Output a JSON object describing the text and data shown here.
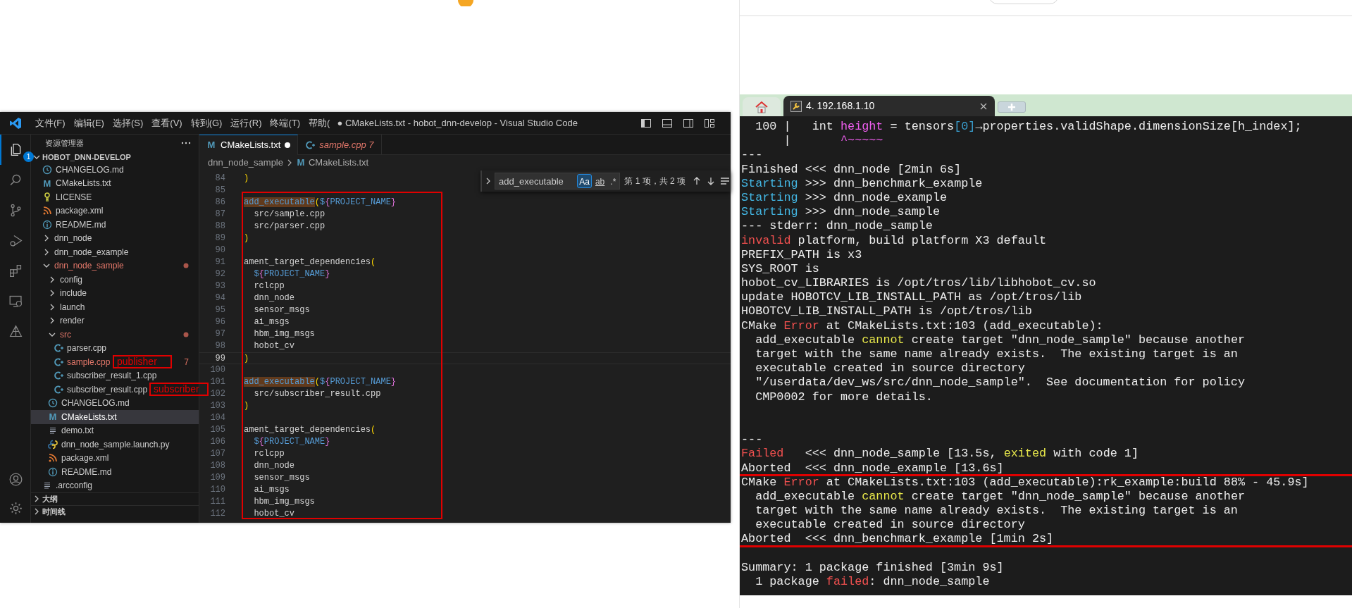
{
  "vscode": {
    "menu": [
      "文件(F)",
      "编辑(E)",
      "选择(S)",
      "查看(V)",
      "转到(G)",
      "运行(R)",
      "终端(T)",
      "帮助("
    ],
    "title": "● CMakeLists.txt - hobot_dnn-develop - Visual Studio Code",
    "activity_bar": [
      {
        "kind": "explorer",
        "selected": true,
        "badge": "1"
      },
      {
        "kind": "search",
        "selected": false
      },
      {
        "kind": "source_control",
        "selected": false
      },
      {
        "kind": "run",
        "selected": false
      },
      {
        "kind": "extensions",
        "selected": false
      },
      {
        "kind": "remote",
        "selected": false
      },
      {
        "kind": "deploy",
        "selected": false
      },
      {
        "kind": "account",
        "selected": false
      },
      {
        "kind": "settings",
        "selected": false
      }
    ],
    "explorer": {
      "title": "资源管理器",
      "root": {
        "label": "HOBOT_DNN-DEVELOP",
        "expanded": true,
        "children": [
          {
            "label": "CHANGELOG.md",
            "kind": "changelog",
            "modified": false,
            "selected": false
          },
          {
            "label": "CMakeLists.txt",
            "kind": "cmake",
            "glyph": "M",
            "modified": false,
            "selected": false
          },
          {
            "label": "LICENSE",
            "kind": "license",
            "modified": false,
            "selected": false
          },
          {
            "label": "package.xml",
            "kind": "xml",
            "modified": false,
            "selected": false
          },
          {
            "label": "README.md",
            "kind": "info",
            "modified": false,
            "selected": false
          },
          {
            "label": "dnn_node",
            "kind": "folder",
            "expanded": false,
            "modified": false,
            "selected": false
          },
          {
            "label": "dnn_node_example",
            "kind": "folder",
            "expanded": false,
            "modified": false,
            "selected": false
          },
          {
            "label": "dnn_node_sample",
            "kind": "folder",
            "expanded": true,
            "modified": true,
            "selected": false,
            "children": [
              {
                "label": "config",
                "kind": "folder",
                "expanded": false,
                "modified": false,
                "selected": false
              },
              {
                "label": "include",
                "kind": "folder",
                "expanded": false,
                "modified": false,
                "selected": false
              },
              {
                "label": "launch",
                "kind": "folder",
                "expanded": false,
                "modified": false,
                "selected": false
              },
              {
                "label": "render",
                "kind": "folder",
                "expanded": false,
                "modified": false,
                "selected": false
              },
              {
                "label": "src",
                "kind": "folder",
                "expanded": true,
                "modified": true,
                "selected": false,
                "children": [
                  {
                    "label": "parser.cpp",
                    "kind": "cpp",
                    "modified": false,
                    "selected": false
                  },
                  {
                    "label": "sample.cpp",
                    "kind": "cpp",
                    "modified": true,
                    "badge": "7",
                    "selected": false
                  },
                  {
                    "label": "subscriber_result_1.cpp",
                    "kind": "cpp",
                    "modified": false,
                    "selected": false
                  },
                  {
                    "label": "subscriber_result.cpp",
                    "kind": "cpp",
                    "modified": false,
                    "selected": false
                  }
                ]
              },
              {
                "label": "CHANGELOG.md",
                "kind": "changelog",
                "modified": false,
                "selected": false
              },
              {
                "label": "CMakeLists.txt",
                "kind": "cmake",
                "glyph": "M",
                "modified": false,
                "selected": true
              },
              {
                "label": "demo.txt",
                "kind": "text",
                "modified": false,
                "selected": false
              },
              {
                "label": "dnn_node_sample.launch.py",
                "kind": "python",
                "modified": false,
                "selected": false
              },
              {
                "label": "package.xml",
                "kind": "xml",
                "modified": false,
                "selected": false
              },
              {
                "label": "README.md",
                "kind": "info",
                "modified": false,
                "selected": false
              }
            ]
          },
          {
            "label": ".arcconfig",
            "kind": "text",
            "modified": false,
            "selected": false
          }
        ]
      },
      "sections": [
        {
          "label": "大纲",
          "expanded": false
        },
        {
          "label": "时间线",
          "expanded": false
        }
      ]
    },
    "tabs": [
      {
        "label": "CMakeLists.txt",
        "kind": "cmake",
        "glyph": "M",
        "selected": true,
        "dirty": true,
        "preview": false,
        "errors": false
      },
      {
        "label": "sample.cpp 7",
        "kind": "cpp",
        "selected": false,
        "dirty": false,
        "preview": true,
        "errors": true
      }
    ],
    "breadcrumb": [
      {
        "label": "dnn_node_sample",
        "kind": "folder"
      },
      {
        "label": "CMakeLists.txt",
        "kind": "cmake",
        "glyph": "M"
      }
    ],
    "find": {
      "value": "add_executable",
      "options": [
        {
          "label": "Aa",
          "on": true
        },
        {
          "label": "ab",
          "on": false
        },
        {
          "label": ".*",
          "on": false
        }
      ],
      "result": "第 1 项，共 2 项"
    },
    "code": [
      {
        "number": "84",
        "current": false,
        "tokens": [
          {
            "text": ")",
            "kind": "paren"
          }
        ]
      },
      {
        "number": "85",
        "current": false
      },
      {
        "number": "86",
        "current": false,
        "tokens": [
          {
            "text": "add_executable",
            "kind": "match"
          },
          {
            "text": "(",
            "kind": "paren"
          },
          {
            "text": "$",
            "kind": "var"
          },
          {
            "text": "{",
            "kind": "brace"
          },
          {
            "text": "PROJECT_NAME",
            "kind": "var"
          },
          {
            "text": "}",
            "kind": "brace"
          }
        ]
      },
      {
        "number": "87",
        "current": false,
        "tokens": [
          {
            "text": "  src/sample.cpp"
          }
        ]
      },
      {
        "number": "88",
        "current": false,
        "tokens": [
          {
            "text": "  src/parser.cpp"
          }
        ]
      },
      {
        "number": "89",
        "current": false,
        "tokens": [
          {
            "text": ")",
            "kind": "paren"
          }
        ]
      },
      {
        "number": "90",
        "current": false
      },
      {
        "number": "91",
        "current": false,
        "tokens": [
          {
            "text": "ament_target_dependencies"
          },
          {
            "text": "(",
            "kind": "paren"
          }
        ]
      },
      {
        "number": "92",
        "current": false,
        "tokens": [
          {
            "text": "  $",
            "kind": "var"
          },
          {
            "text": "{",
            "kind": "brace"
          },
          {
            "text": "PROJECT_NAME",
            "kind": "var"
          },
          {
            "text": "}",
            "kind": "brace"
          }
        ]
      },
      {
        "number": "93",
        "current": false,
        "tokens": [
          {
            "text": "  rclcpp"
          }
        ]
      },
      {
        "number": "94",
        "current": false,
        "tokens": [
          {
            "text": "  dnn_node"
          }
        ]
      },
      {
        "number": "95",
        "current": false,
        "tokens": [
          {
            "text": "  sensor_msgs"
          }
        ]
      },
      {
        "number": "96",
        "current": false,
        "tokens": [
          {
            "text": "  ai_msgs"
          }
        ]
      },
      {
        "number": "97",
        "current": false,
        "tokens": [
          {
            "text": "  hbm_img_msgs"
          }
        ]
      },
      {
        "number": "98",
        "current": false,
        "tokens": [
          {
            "text": "  hobot_cv"
          }
        ]
      },
      {
        "number": "99",
        "current": true,
        "tokens": [
          {
            "text": ")",
            "kind": "paren"
          }
        ]
      },
      {
        "number": "100",
        "current": false
      },
      {
        "number": "101",
        "current": false,
        "tokens": [
          {
            "text": "add_executable",
            "kind": "match"
          },
          {
            "text": "(",
            "kind": "paren"
          },
          {
            "text": "$",
            "kind": "var"
          },
          {
            "text": "{",
            "kind": "brace"
          },
          {
            "text": "PROJECT_NAME",
            "kind": "var"
          },
          {
            "text": "}",
            "kind": "brace"
          }
        ]
      },
      {
        "number": "102",
        "current": false,
        "tokens": [
          {
            "text": "  src/subscriber_result.cpp"
          }
        ]
      },
      {
        "number": "103",
        "current": false,
        "tokens": [
          {
            "text": ")",
            "kind": "paren"
          }
        ]
      },
      {
        "number": "104",
        "current": false
      },
      {
        "number": "105",
        "current": false,
        "tokens": [
          {
            "text": "ament_target_dependencies"
          },
          {
            "text": "(",
            "kind": "paren"
          }
        ]
      },
      {
        "number": "106",
        "current": false,
        "tokens": [
          {
            "text": "  $",
            "kind": "var"
          },
          {
            "text": "{",
            "kind": "brace"
          },
          {
            "text": "PROJECT_NAME",
            "kind": "var"
          },
          {
            "text": "}",
            "kind": "brace"
          }
        ]
      },
      {
        "number": "107",
        "current": false,
        "tokens": [
          {
            "text": "  rclcpp"
          }
        ]
      },
      {
        "number": "108",
        "current": false,
        "tokens": [
          {
            "text": "  dnn_node"
          }
        ]
      },
      {
        "number": "109",
        "current": false,
        "tokens": [
          {
            "text": "  sensor_msgs"
          }
        ]
      },
      {
        "number": "110",
        "current": false,
        "tokens": [
          {
            "text": "  ai_msgs"
          }
        ]
      },
      {
        "number": "111",
        "current": false,
        "tokens": [
          {
            "text": "  hbm_img_msgs"
          }
        ]
      },
      {
        "number": "112",
        "current": false,
        "tokens": [
          {
            "text": "  hobot_cv"
          }
        ]
      }
    ],
    "annotations": [
      {
        "label": "publisher"
      },
      {
        "label": "subscriber"
      }
    ]
  },
  "terminal": {
    "tabs": [
      {
        "kind": "home",
        "selected": false
      },
      {
        "kind": "session",
        "label": "4. 192.168.1.10",
        "selected": true
      }
    ],
    "lines": [
      {
        "kind": "text",
        "segments": [
          {
            "text": "  100 |   int "
          },
          {
            "text": "height",
            "kind": "magenta"
          },
          {
            "text": " = tensors"
          },
          {
            "text": "[0]",
            "kind": "blue"
          },
          {
            "text": "→properties.validShape.dimensionSize[h_index];"
          }
        ]
      },
      {
        "kind": "text",
        "segments": [
          {
            "text": "      |       "
          },
          {
            "text": "^~~~~~",
            "kind": "magenta"
          }
        ]
      },
      {
        "kind": "text",
        "segments": [
          {
            "text": "---"
          }
        ]
      },
      {
        "kind": "text",
        "segments": [
          {
            "text": "Finished <<< dnn_node [2min 6s]"
          }
        ]
      },
      {
        "kind": "text",
        "segments": [
          {
            "text": "Starting",
            "kind": "cyan"
          },
          {
            "text": " >>> dnn_benchmark_example"
          }
        ]
      },
      {
        "kind": "text",
        "segments": [
          {
            "text": "Starting",
            "kind": "cyan"
          },
          {
            "text": " >>> dnn_node_example"
          }
        ]
      },
      {
        "kind": "text",
        "segments": [
          {
            "text": "Starting",
            "kind": "cyan"
          },
          {
            "text": " >>> dnn_node_sample"
          }
        ]
      },
      {
        "kind": "text",
        "segments": [
          {
            "text": "--- stderr: dnn_node_sample"
          }
        ]
      },
      {
        "kind": "text",
        "segments": [
          {
            "text": "invalid",
            "kind": "red"
          },
          {
            "text": " platform, build platform X3 default"
          }
        ]
      },
      {
        "kind": "text",
        "segments": [
          {
            "text": "PREFIX_PATH is x3"
          }
        ]
      },
      {
        "kind": "text",
        "segments": [
          {
            "text": "SYS_ROOT is"
          }
        ]
      },
      {
        "kind": "text",
        "segments": [
          {
            "text": "hobot_cv_LIBRARIES is /opt/tros/lib/libhobot_cv.so"
          }
        ]
      },
      {
        "kind": "text",
        "segments": [
          {
            "text": "update HOBOTCV_LIB_INSTALL_PATH as /opt/tros/lib"
          }
        ]
      },
      {
        "kind": "text",
        "segments": [
          {
            "text": "HOBOTCV_LIB_INSTALL_PATH is /opt/tros/lib"
          }
        ]
      },
      {
        "kind": "text",
        "segments": [
          {
            "text": "CMake "
          },
          {
            "text": "Error",
            "kind": "red"
          },
          {
            "text": " at CMakeLists.txt:103 (add_executable):"
          }
        ]
      },
      {
        "kind": "text",
        "segments": [
          {
            "text": "  add_executable "
          },
          {
            "text": "cannot",
            "kind": "yellow"
          },
          {
            "text": " create target \"dnn_node_sample\" because another"
          }
        ]
      },
      {
        "kind": "text",
        "segments": [
          {
            "text": "  target with the same name already exists.  The existing target is an"
          }
        ]
      },
      {
        "kind": "text",
        "segments": [
          {
            "text": "  executable created in source directory"
          }
        ]
      },
      {
        "kind": "text",
        "segments": [
          {
            "text": "  \"/userdata/dev_ws/src/dnn_node_sample\".  See documentation for policy"
          }
        ]
      },
      {
        "kind": "text",
        "segments": [
          {
            "text": "  CMP0002 for more details."
          }
        ]
      },
      {
        "kind": "blank"
      },
      {
        "kind": "blank"
      },
      {
        "kind": "text",
        "segments": [
          {
            "text": "---"
          }
        ]
      },
      {
        "kind": "text",
        "segments": [
          {
            "text": "Failed",
            "kind": "red"
          },
          {
            "text": "   <<< dnn_node_sample [13.5s, "
          },
          {
            "text": "exited",
            "kind": "yellow"
          },
          {
            "text": " with code 1]"
          }
        ]
      },
      {
        "kind": "text",
        "segments": [
          {
            "text": "Aborted  <<< dnn_node_example [13.6s]"
          }
        ]
      },
      {
        "kind": "rule"
      },
      {
        "kind": "text",
        "segments": [
          {
            "text": "CMake "
          },
          {
            "text": "Error",
            "kind": "red"
          },
          {
            "text": " at CMakeLists.txt:103 (add_executable):rk_example:build 88% - 45.9s]"
          }
        ]
      },
      {
        "kind": "text",
        "segments": [
          {
            "text": "  add_executable "
          },
          {
            "text": "cannot",
            "kind": "yellow"
          },
          {
            "text": " create target \"dnn_node_sample\" because another"
          }
        ]
      },
      {
        "kind": "text",
        "segments": [
          {
            "text": "  target with the same name already exists.  The existing target is an"
          }
        ]
      },
      {
        "kind": "text",
        "segments": [
          {
            "text": "  executable created in source directory"
          }
        ]
      },
      {
        "kind": "text",
        "segments": [
          {
            "text": "Aborted  <<< dnn_benchmark_example [1min 2s]"
          }
        ]
      },
      {
        "kind": "rule"
      },
      {
        "kind": "blank"
      },
      {
        "kind": "text",
        "segments": [
          {
            "text": "Summary: 1 package finished [3min 9s]"
          }
        ]
      },
      {
        "kind": "text",
        "segments": [
          {
            "text": "  1 package "
          },
          {
            "text": "failed",
            "kind": "red"
          },
          {
            "text": ": dnn_node_sample"
          }
        ]
      }
    ]
  }
}
